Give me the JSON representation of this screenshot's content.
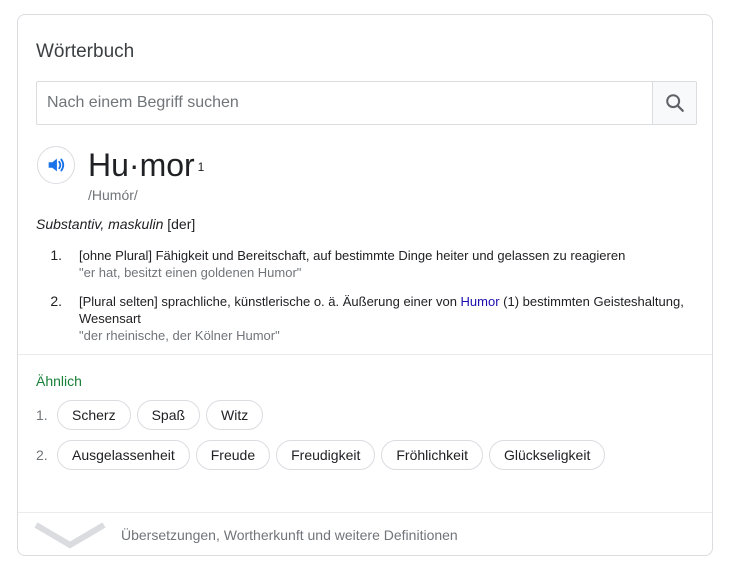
{
  "card": {
    "title": "Wörterbuch"
  },
  "search": {
    "placeholder": "Nach einem Begriff suchen",
    "value": "",
    "icon": "search-icon"
  },
  "entry": {
    "audio_icon": "speaker-icon",
    "headword": "Hu·mor",
    "superscript": "1",
    "phonetic": "/Humór/",
    "pos_italic": "Substantiv, maskulin",
    "pos_gender": "[der]",
    "definitions": [
      {
        "number": "1.",
        "text": "[ohne Plural] Fähigkeit und Bereitschaft, auf bestimmte Dinge heiter und gelassen zu reagieren",
        "example": "\"er hat, besitzt einen goldenen Humor\""
      },
      {
        "number": "2.",
        "text_before": "[Plural selten] sprachliche, künstlerische o. ä. Äußerung einer von ",
        "link": "Humor",
        "text_after": " (1) bestimmten Geisteshaltung, Wesensart",
        "example": "\"der rheinische, der Kölner Humor\""
      }
    ]
  },
  "similar": {
    "label": "Ähnlich",
    "groups": [
      {
        "number": "1.",
        "words": [
          "Scherz",
          "Spaß",
          "Witz"
        ]
      },
      {
        "number": "2.",
        "words": [
          "Ausgelassenheit",
          "Freude",
          "Freudigkeit",
          "Fröhlichkeit",
          "Glückseligkeit"
        ]
      }
    ]
  },
  "footer": {
    "icon": "chevron-down-icon",
    "text": "Übersetzungen, Wortherkunft und weitere Definitionen"
  },
  "colors": {
    "accent_blue": "#1a73e8",
    "similar_green": "#188038",
    "link_blue": "#1a0dab",
    "muted_gray": "#70757a"
  }
}
